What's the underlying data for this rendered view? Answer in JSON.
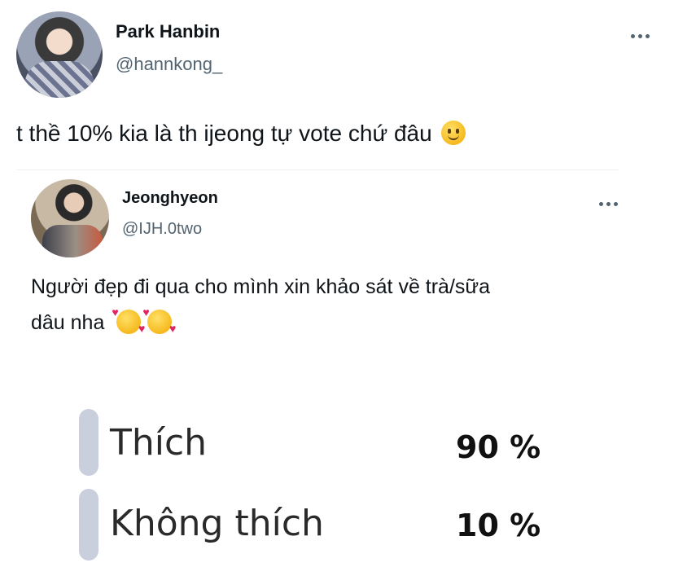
{
  "tweet": {
    "author_name": "Park Hanbin",
    "author_handle": "@hannkong_",
    "text": "t thề 10% kia là th ijeong tự vote chứ đâu",
    "emoji": "slightly-smiling-face"
  },
  "quoted_tweet": {
    "author_name": "Jeonghyeon",
    "author_handle": "@IJH.0two",
    "text_line1": "Người đẹp đi qua cho mình xin khảo sát về trà/sữa",
    "text_line2": "dâu nha",
    "emojis": [
      "smiling-face-with-hearts",
      "smiling-face-with-hearts"
    ]
  },
  "poll": {
    "options": [
      {
        "label": "Thích",
        "percent_text": "90 %",
        "percent": 90
      },
      {
        "label": "Không thích",
        "percent_text": "10 %",
        "percent": 10
      }
    ]
  }
}
